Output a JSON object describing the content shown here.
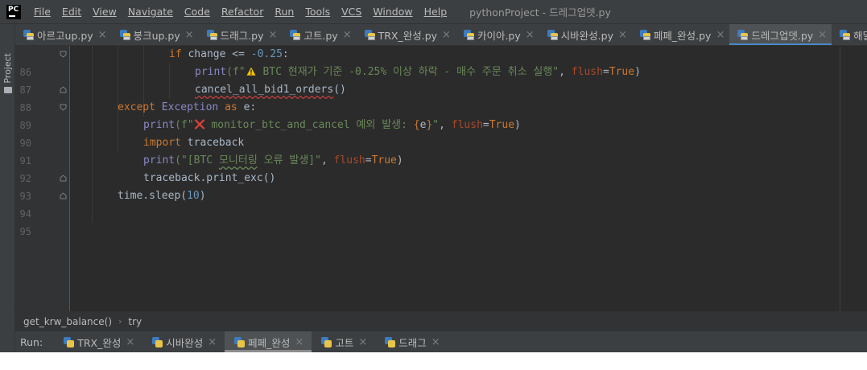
{
  "menubar": {
    "logo": "PC",
    "items": [
      {
        "label": "File"
      },
      {
        "label": "Edit"
      },
      {
        "label": "View"
      },
      {
        "label": "Navigate"
      },
      {
        "label": "Code"
      },
      {
        "label": "Refactor"
      },
      {
        "label": "Run"
      },
      {
        "label": "Tools"
      },
      {
        "label": "VCS"
      },
      {
        "label": "Window"
      },
      {
        "label": "Help"
      }
    ],
    "window_title": "pythonProject - 드레그업뎃.py"
  },
  "left_strip": {
    "project_label": "Project"
  },
  "tabs": [
    {
      "label": "아르고up.py"
    },
    {
      "label": "붕크up.py"
    },
    {
      "label": "드래그.py"
    },
    {
      "label": "고트.py"
    },
    {
      "label": "TRX_완성.py"
    },
    {
      "label": "카이아.py"
    },
    {
      "label": "시바완성.py"
    },
    {
      "label": "페페_완성.py"
    },
    {
      "label": "드레그업뎃.py",
      "active": true
    },
    {
      "label": "해달up.py"
    }
  ],
  "editor": {
    "line_numbers": [
      "86",
      "87",
      "88",
      "89",
      "90",
      "91",
      "92",
      "93",
      "94",
      "95"
    ],
    "lines": {
      "l86": {
        "kw_if": "if",
        "var": "change",
        "op": "<=",
        "num": "-0.25",
        "colon": ":"
      },
      "l87": {
        "call": "print",
        "p1": "(f\"",
        "text": " BTC 현재가 기준 -0.25% 이상 하락 - 매수 주문 취소 실행\"",
        "comma": ", ",
        "kw": "flush",
        "eq": "=",
        "val": "True",
        "close": ")"
      },
      "l88": {
        "call": "cancel_all_bid1_orders",
        "paren": "()"
      },
      "l89": {
        "kw_except": "except",
        "cls": "Exception",
        "kw_as": "as",
        "var": "e",
        "colon": ":"
      },
      "l90": {
        "call": "print",
        "p1": "(f\"",
        "text_a": " monitor_btc_and_cancel 예외 발생: ",
        "brace_open": "{",
        "var": "e",
        "brace_close": "}",
        "text_b": "\"",
        "comma": ", ",
        "kw": "flush",
        "eq": "=",
        "val": "True",
        "close": ")"
      },
      "l91": {
        "kw_import": "import",
        "mod": "traceback"
      },
      "l92": {
        "call": "print",
        "p1": "(\"[BTC ",
        "text_sq": "모니터링",
        "text_b": " 오류 발생]\"",
        "comma": ", ",
        "kw": "flush",
        "eq": "=",
        "val": "True",
        "close": ")"
      },
      "l93": {
        "code": "traceback.print_exc()"
      },
      "l94": {
        "pre": "time.sleep(",
        "num": "10",
        "close": ")"
      }
    }
  },
  "breadcrumb": {
    "func": "get_krw_balance()",
    "block": "try"
  },
  "runbar": {
    "label": "Run:",
    "tabs": [
      {
        "label": "TRX_완성"
      },
      {
        "label": "시바완성"
      },
      {
        "label": "페페_완성",
        "active": true
      },
      {
        "label": "고트"
      },
      {
        "label": "드래그"
      }
    ]
  },
  "colors": {
    "accent": "#4a88c7",
    "keyword": "#cc7832",
    "string": "#6a8759",
    "number": "#6897bb",
    "param": "#aa4926",
    "builtin": "#8888c6"
  }
}
